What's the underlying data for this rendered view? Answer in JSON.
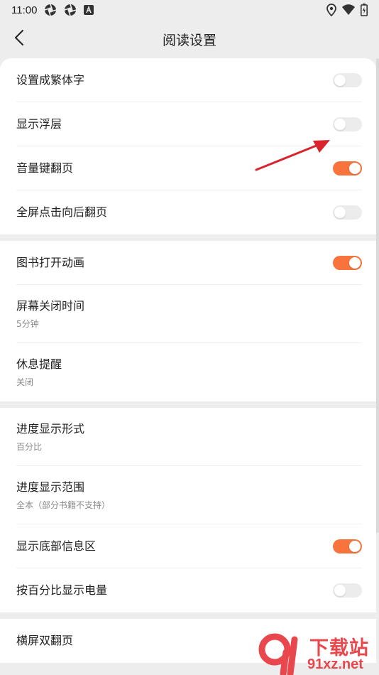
{
  "status_bar": {
    "time": "11:00",
    "left_icons": [
      "aperture-icon",
      "aperture-icon",
      "font-a-icon"
    ],
    "right_icons": [
      "location-icon",
      "wifi-icon",
      "battery-icon"
    ]
  },
  "header": {
    "title": "阅读设置",
    "back_icon": "chevron-left-icon"
  },
  "colors": {
    "accent": "#f9743c",
    "background": "#ededed",
    "card": "#ffffff",
    "toggle_off": "#ececec",
    "subtitle": "#888888",
    "arrow": "#d9232d",
    "watermark": "#e8474d"
  },
  "groups": [
    {
      "items": [
        {
          "title": "设置成繁体字",
          "toggle": false
        },
        {
          "title": "显示浮层",
          "toggle": false
        },
        {
          "title": "音量键翻页",
          "toggle": true
        },
        {
          "title": "全屏点击向后翻页",
          "toggle": false
        }
      ]
    },
    {
      "items": [
        {
          "title": "图书打开动画",
          "toggle": true
        },
        {
          "title": "屏幕关闭时间",
          "subtitle": "5分钟"
        },
        {
          "title": "休息提醒",
          "subtitle": "关闭"
        }
      ]
    },
    {
      "items": [
        {
          "title": "进度显示形式",
          "subtitle": "百分比"
        },
        {
          "title": "进度显示范围",
          "subtitle": "全本（部分书籍不支持）"
        },
        {
          "title": "显示底部信息区",
          "toggle": true
        },
        {
          "title": "按百分比显示电量",
          "toggle": false
        }
      ]
    },
    {
      "items": [
        {
          "title": "横屏双翻页"
        }
      ]
    }
  ],
  "watermark": {
    "top_text": "下载站",
    "bottom_text": "91xz.net"
  }
}
